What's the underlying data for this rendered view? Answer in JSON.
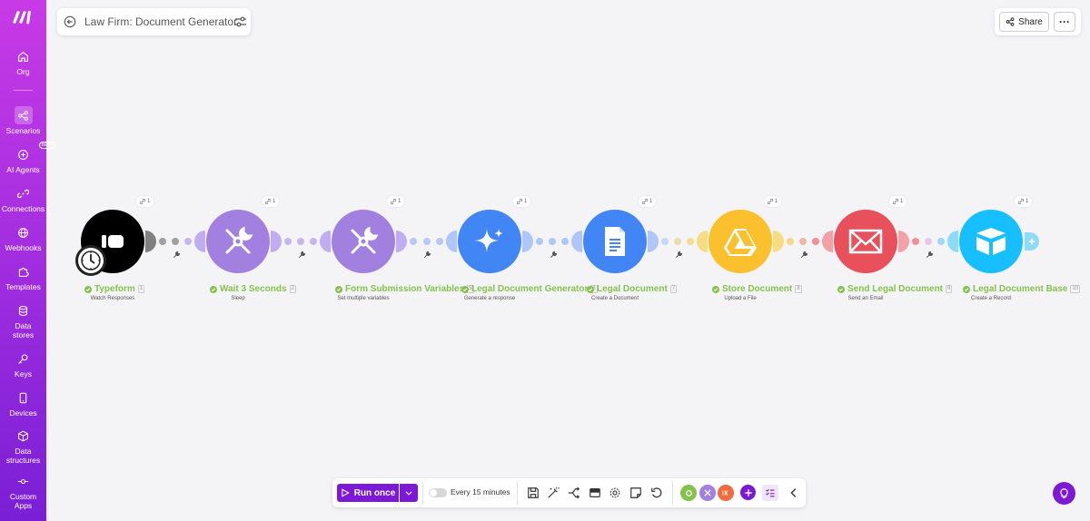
{
  "sidebar": {
    "items": [
      {
        "label": "Org",
        "icon": "home-icon"
      },
      {
        "label": "Scenarios",
        "icon": "share-nodes-icon"
      },
      {
        "label": "AI Agents",
        "icon": "ai-agent-icon",
        "badge": "BETA"
      },
      {
        "label": "Connections",
        "icon": "link-icon"
      },
      {
        "label": "Webhooks",
        "icon": "globe-icon"
      },
      {
        "label": "Templates",
        "icon": "puzzle-icon"
      },
      {
        "label": "Data stores",
        "icon": "database-icon"
      },
      {
        "label": "Keys",
        "icon": "key-icon"
      },
      {
        "label": "Devices",
        "icon": "phone-icon"
      },
      {
        "label": "Data structures",
        "icon": "cube-icon"
      },
      {
        "label": "Custom Apps",
        "icon": "commit-icon"
      }
    ]
  },
  "header": {
    "title": "Law Firm: Document Generator",
    "share_label": "Share",
    "more_label": "···"
  },
  "modules": [
    {
      "name": "Typeform",
      "subtitle": "Watch Responses",
      "number": "1",
      "ops": "1",
      "color": "#000000"
    },
    {
      "name": "Wait 3 Seconds",
      "subtitle": "Sleep",
      "number": "2",
      "ops": "1",
      "color": "#a180e0"
    },
    {
      "name": "Form Submission Variables",
      "subtitle": "Set multiple variables",
      "number": "5",
      "ops": "1",
      "color": "#a180e0"
    },
    {
      "name": "Legal Document Generator",
      "subtitle": "Generate a response",
      "number": "6",
      "ops": "1",
      "color": "#4285f4"
    },
    {
      "name": "Legal Document",
      "subtitle": "Create a Document",
      "number": "7",
      "ops": "1",
      "color": "#4285f4"
    },
    {
      "name": "Store Document",
      "subtitle": "Upload a File",
      "number": "8",
      "ops": "1",
      "color": "#fbc02d"
    },
    {
      "name": "Send Legal Document",
      "subtitle": "Send an Email",
      "number": "9",
      "ops": "1",
      "color": "#e8505b"
    },
    {
      "name": "Legal Document Base",
      "subtitle": "Create a Record",
      "number": "10",
      "ops": "1",
      "color": "#18bfff"
    }
  ],
  "toolbar": {
    "run_label": "Run once",
    "schedule_label": "Every 15 minutes",
    "accent": "#7b19d5"
  }
}
